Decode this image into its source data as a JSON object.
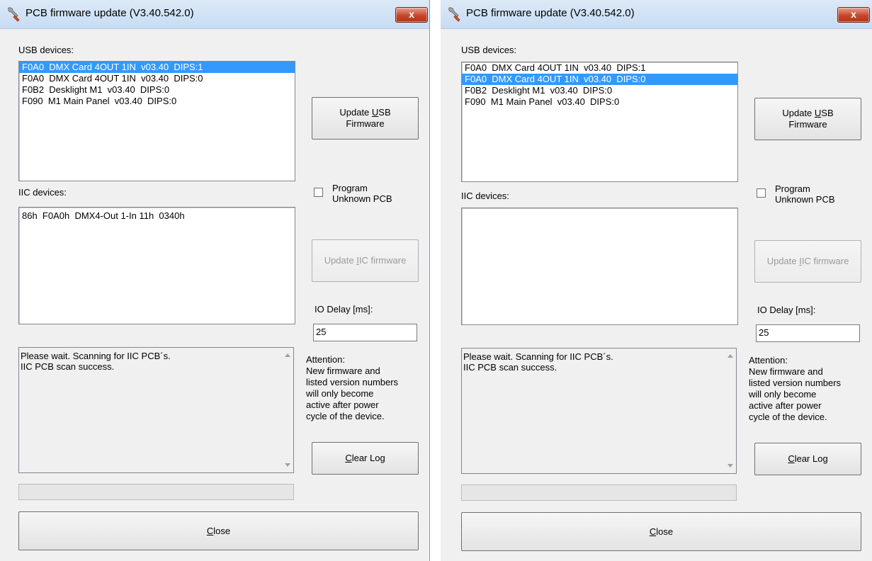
{
  "windows": [
    {
      "title": "PCB firmware update (V3.40.542.0)",
      "close_glyph": "x",
      "usb_label": "USB devices:",
      "usb_devices": [
        {
          "text": "F0A0  DMX Card 4OUT 1IN  v03.40  DIPS:1",
          "selected": true
        },
        {
          "text": "F0A0  DMX Card 4OUT 1IN  v03.40  DIPS:0",
          "selected": false
        },
        {
          "text": "F0B2  Desklight M1  v03.40  DIPS:0",
          "selected": false
        },
        {
          "text": "F090  M1 Main Panel  v03.40  DIPS:0",
          "selected": false
        }
      ],
      "update_usb": {
        "pre": "Update ",
        "accel": "U",
        "post": "SB",
        "line2": "Firmware"
      },
      "program_unknown": {
        "line1": "Program",
        "line2": "Unknown PCB",
        "checked": false
      },
      "iic_label": "IIC devices:",
      "iic_devices": [
        "86h  F0A0h  DMX4-Out 1-In 11h  0340h"
      ],
      "update_iic": {
        "pre": "Update ",
        "accel": "I",
        "post": "IC firmware",
        "disabled": true
      },
      "io_delay_label": "IO Delay [ms]:",
      "io_delay_value": "25",
      "log_text": "Please wait. Scanning for IIC PCB´s.\nIIC PCB scan success.",
      "attention": "Attention:\nNew firmware and\nlisted version numbers\nwill only become\nactive after power\ncycle of the device.",
      "clear_log": {
        "accel": "C",
        "post": "lear Log"
      },
      "close": {
        "accel": "C",
        "post": "lose"
      }
    },
    {
      "title": "PCB firmware update (V3.40.542.0)",
      "close_glyph": "x",
      "usb_label": "USB devices:",
      "usb_devices": [
        {
          "text": "F0A0  DMX Card 4OUT 1IN  v03.40  DIPS:1",
          "selected": false
        },
        {
          "text": "F0A0  DMX Card 4OUT 1IN  v03.40  DIPS:0",
          "selected": true
        },
        {
          "text": "F0B2  Desklight M1  v03.40  DIPS:0",
          "selected": false
        },
        {
          "text": "F090  M1 Main Panel  v03.40  DIPS:0",
          "selected": false
        }
      ],
      "update_usb": {
        "pre": "Update ",
        "accel": "U",
        "post": "SB",
        "line2": "Firmware"
      },
      "program_unknown": {
        "line1": "Program",
        "line2": "Unknown PCB",
        "checked": false
      },
      "iic_label": "IIC devices:",
      "iic_devices": [],
      "update_iic": {
        "pre": "Update ",
        "accel": "I",
        "post": "IC firmware",
        "disabled": true
      },
      "io_delay_label": "IO Delay [ms]:",
      "io_delay_value": "25",
      "log_text": "Please wait. Scanning for IIC PCB´s.\nIIC PCB scan success.",
      "attention": "Attention:\nNew firmware and\nlisted version numbers\nwill only become\nactive after power\ncycle of the device.",
      "clear_log": {
        "accel": "C",
        "post": "lear Log"
      },
      "close": {
        "accel": "C",
        "post": "lose"
      }
    }
  ],
  "icons": {
    "title": "wrench-icon",
    "close": "close-icon"
  },
  "colors": {
    "selection": "#3399ff",
    "close_button": "#c6452c",
    "window_bg": "#f0f0f0"
  }
}
